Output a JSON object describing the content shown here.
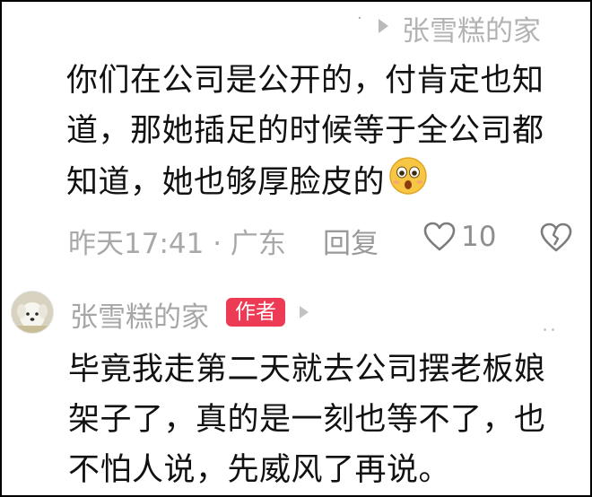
{
  "thread": {
    "reply_to_name": "张雪糕的家",
    "comment1": {
      "lines": [
        "你们在公司是公开的，付肯定也知",
        "道，那她插足的时候等于全公司都",
        "知道，她也够厚脸皮的"
      ],
      "emoji_icon": "surprised-face-emoji",
      "time_location": "昨天17:41 · 广东",
      "reply_label": "回复",
      "like_count": "10",
      "like_icon": "heart-outline-icon",
      "dislike_icon": "broken-heart-icon"
    },
    "comment2": {
      "avatar_icon": "dog-avatar",
      "author_name": "张雪糕的家",
      "author_badge": "作者",
      "lines": [
        "毕竟我走第二天就去公司摆老板娘",
        "架子了，真的是一刻也等不了，也",
        "不怕人说，先威风了再说。"
      ]
    }
  },
  "colors": {
    "text": "#111111",
    "meta": "#a8a8a8",
    "badge_bg": "#ee3b55",
    "frame": "#000000"
  }
}
